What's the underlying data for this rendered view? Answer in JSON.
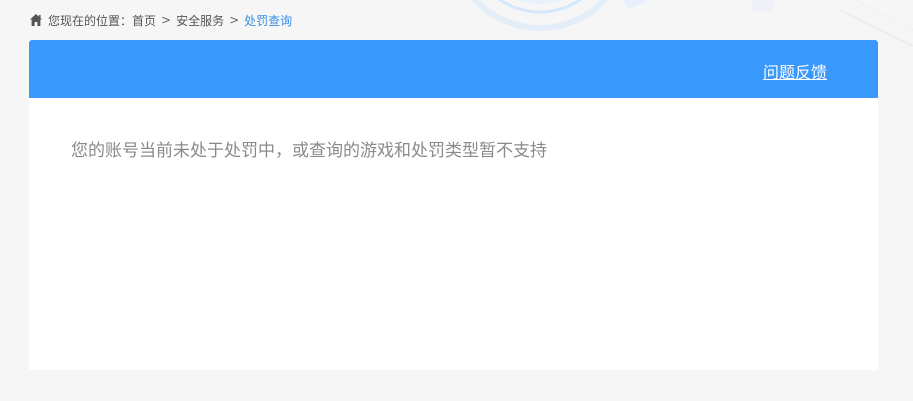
{
  "breadcrumb": {
    "prefix": "您现在的位置：",
    "items": [
      {
        "label": "首页"
      },
      {
        "label": "安全服务"
      },
      {
        "label": "处罚查询"
      }
    ],
    "separator": ">",
    "home_icon": "home-icon"
  },
  "header": {
    "feedback_label": "问题反馈"
  },
  "main": {
    "message": "您的账号当前未处于处罚中，或查询的游戏和处罚类型暂不支持"
  },
  "colors": {
    "accent": "#3898fc",
    "current_breadcrumb": "#3a8fe6",
    "page_background": "#f6f6f6"
  }
}
